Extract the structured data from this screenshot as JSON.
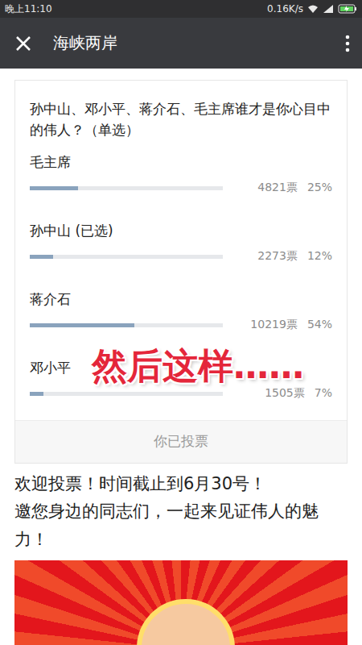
{
  "status_bar": {
    "time": "晚上11:10",
    "speed": "0.16K/s"
  },
  "header": {
    "title": "海峡两岸"
  },
  "poll": {
    "question": "孙中山、邓小平、蒋介石、毛主席谁才是你心目中的伟人？（单选）",
    "options": [
      {
        "label": "毛主席",
        "votes": "4821票",
        "percent": "25%",
        "level": 0.25
      },
      {
        "label": "孙中山 (已选)",
        "votes": "2273票",
        "percent": "12%",
        "level": 0.12
      },
      {
        "label": "蒋介石",
        "votes": "10219票",
        "percent": "54%",
        "level": 0.54
      },
      {
        "label": "邓小平",
        "votes": "1505票",
        "percent": "7%",
        "level": 0.07
      }
    ],
    "button": "你已投票"
  },
  "overlay": "然后这样……",
  "description": [
    "欢迎投票！时间截止到6月30号！",
    "邀您身边的同志们，一起来见证伟人的魅力！"
  ]
}
